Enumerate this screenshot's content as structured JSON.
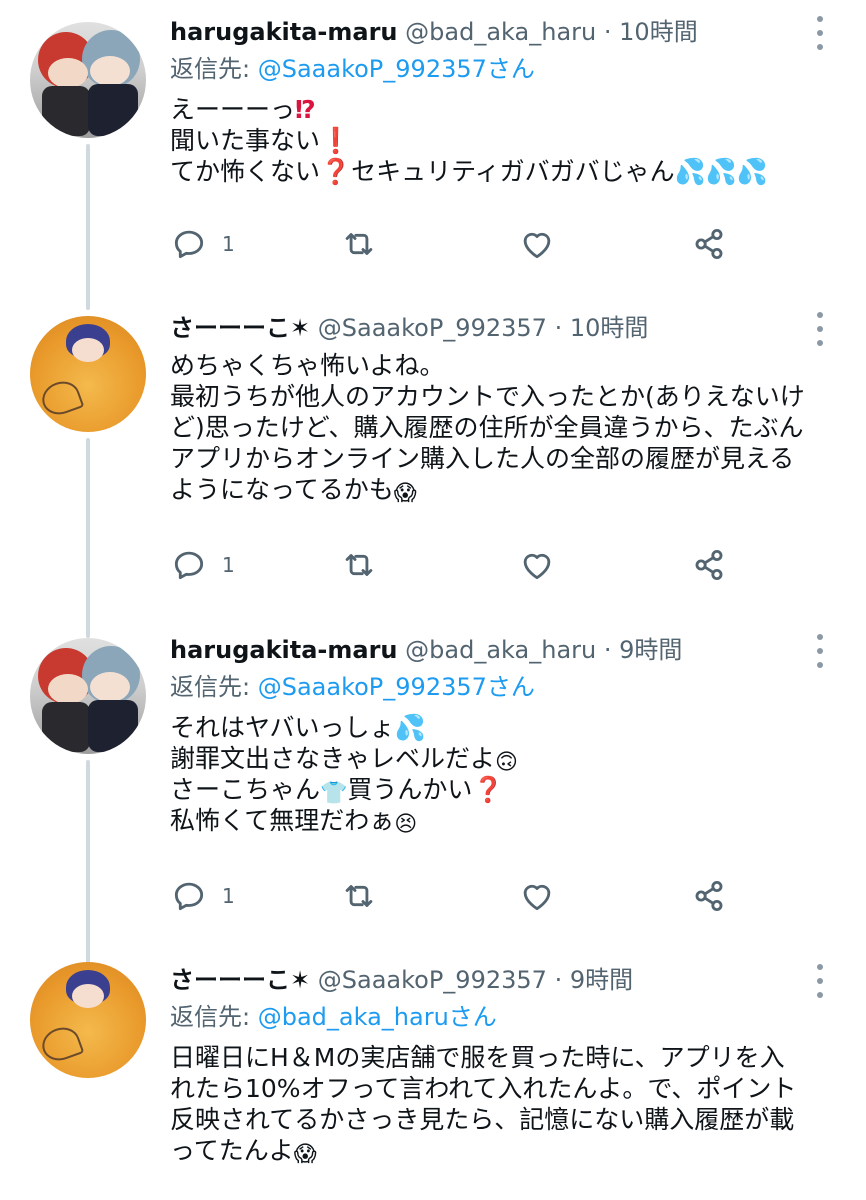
{
  "tweets": [
    {
      "name": "harugakita-maru",
      "handle": "@bad_aka_haru",
      "time": "10時間",
      "reply_prefix": "返信先: ",
      "reply_to": "@SaaakoP_992357さん",
      "lines": [
        "えーーーっ",
        "聞いた事ない",
        "てか怖くない",
        "セキュリティガバガバじゃん"
      ],
      "reply_count": "1"
    },
    {
      "name": "さーーーこ✶",
      "handle": "@SaaakoP_992357",
      "time": "10時間",
      "lines": [
        "めちゃくちゃ怖いよね。",
        "最初うちが他人のアカウントで入ったとか(ありえないけ",
        "ど)思ったけど、購入履歴の住所が全員違うから、たぶん",
        "アプリからオンライン購入した人の全部の履歴が見える",
        "ようになってるかも"
      ],
      "reply_count": "1"
    },
    {
      "name": "harugakita-maru",
      "handle": "@bad_aka_haru",
      "time": "9時間",
      "reply_prefix": "返信先: ",
      "reply_to": "@SaaakoP_992357さん",
      "lines": [
        "それはヤバいっしょ",
        "謝罪文出さなきゃレベルだよ",
        "さーこちゃん",
        "買うんかい",
        "私怖くて無理だわぁ"
      ],
      "reply_count": "1"
    },
    {
      "name": "さーーーこ✶",
      "handle": "@SaaakoP_992357",
      "time": "9時間",
      "reply_prefix": "返信先: ",
      "reply_to": "@bad_aka_haruさん",
      "lines": [
        "日曜日にH＆Mの実店舗で服を買った時に、アプリを入",
        "れたら10%オフって言われて入れたんよ。で、ポイント",
        "反映されてるかさっき見たら、記憶にない購入履歴が載",
        "ってたんよ"
      ]
    }
  ],
  "separator": "·",
  "icons": {
    "reply": "reply-icon",
    "retweet": "retweet-icon",
    "like": "like-icon",
    "share": "share-icon",
    "more": "more-icon"
  },
  "colors": {
    "link": "#1d9bf0",
    "secondary_text": "#536471",
    "thread_line": "#cfd9de"
  }
}
